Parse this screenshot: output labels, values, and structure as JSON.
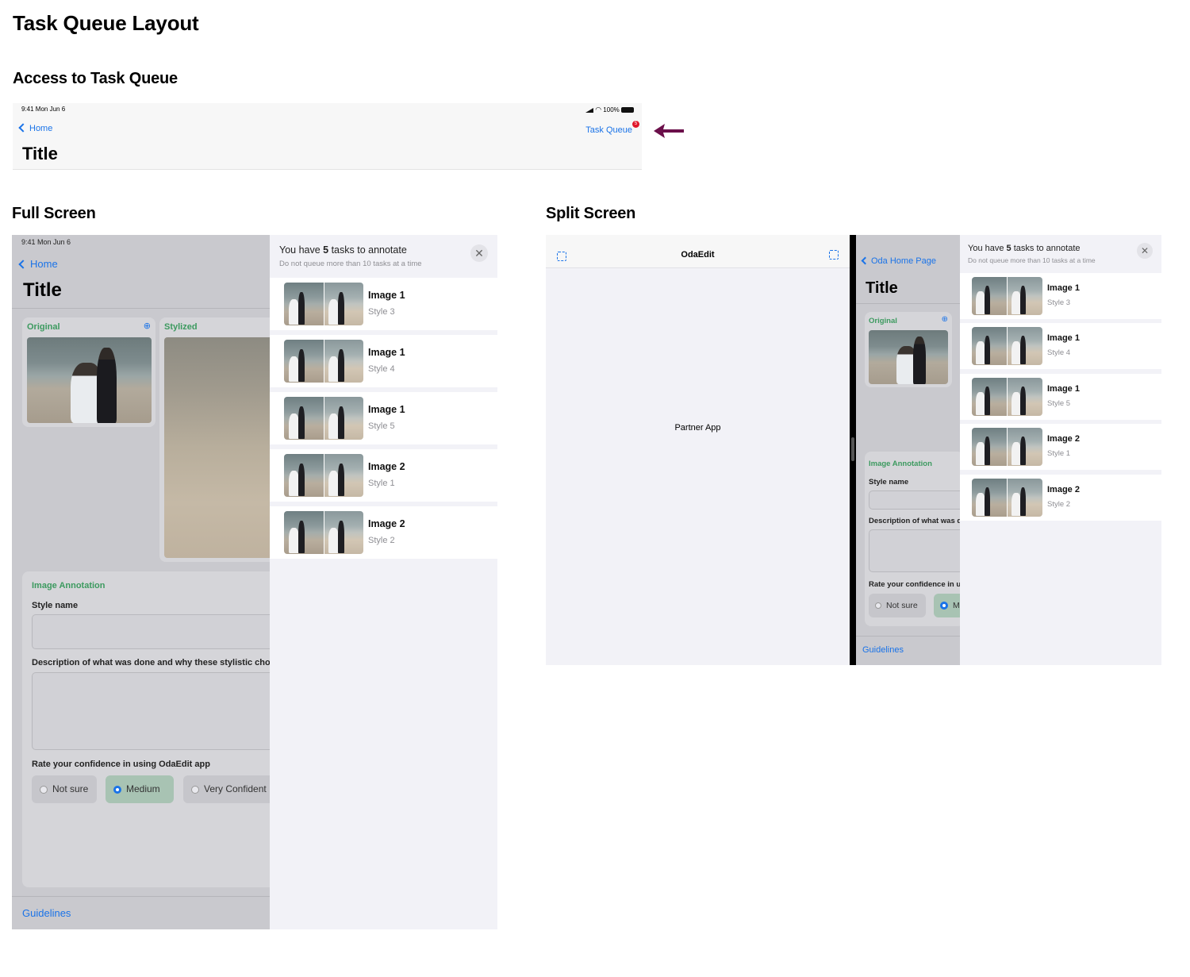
{
  "page_title": "Task Queue Layout",
  "sections": {
    "access": "Access to Task Queue",
    "full": "Full Screen",
    "split": "Split Screen"
  },
  "status_bar": {
    "time": "9:41  Mon Jun 6",
    "battery": "100%"
  },
  "nav": {
    "back_label": "Home",
    "title": "Title",
    "task_queue_label": "Task Queue",
    "task_queue_count": "5"
  },
  "app": {
    "original_label": "Original",
    "stylized_label": "Stylized",
    "annotation_heading": "Image Annotation",
    "style_name_label": "Style name",
    "description_label": "Description of what was done and why these stylistic cho",
    "confidence_label": "Rate your confidence in using OdaEdit app",
    "options": [
      "Not sure",
      "Medium",
      "Very Confident"
    ],
    "selected_option": "Medium",
    "guidelines_label": "Guidelines"
  },
  "queue": {
    "header_prefix": "You have ",
    "count": "5",
    "header_suffix": " tasks to annotate",
    "subtitle": "Do not queue more than 10 tasks at a time",
    "close_glyph": "✕",
    "items": [
      {
        "title": "Image 1",
        "style": "Style 3"
      },
      {
        "title": "Image 1",
        "style": "Style 4"
      },
      {
        "title": "Image 1",
        "style": "Style 5"
      },
      {
        "title": "Image 2",
        "style": "Style 1"
      },
      {
        "title": "Image 2",
        "style": "Style 2"
      }
    ]
  },
  "split": {
    "partner_title": "OdaEdit",
    "partner_body": "Partner App",
    "back_label": "Oda Home Page",
    "title": "Title",
    "original_label": "Original",
    "annotation_heading": "Image Annotation",
    "style_name_label": "Style name",
    "description_label": "Description of what was d",
    "confidence_label": "Rate your confidence in u",
    "option_not_sure": "Not sure",
    "option_medium_partial": "M",
    "guidelines_label": "Guidelines"
  },
  "colors": {
    "accent_blue": "#1a73e8",
    "annotation_green": "#3c9a5f",
    "badge_red": "#e0162b",
    "arrow_purple": "#6b0f4a"
  },
  "icons": [
    "chevron-left-icon",
    "zoom-in-icon",
    "close-icon",
    "split-view-icon",
    "arrow-left-icon",
    "signal-icon",
    "wifi-icon",
    "battery-icon"
  ]
}
